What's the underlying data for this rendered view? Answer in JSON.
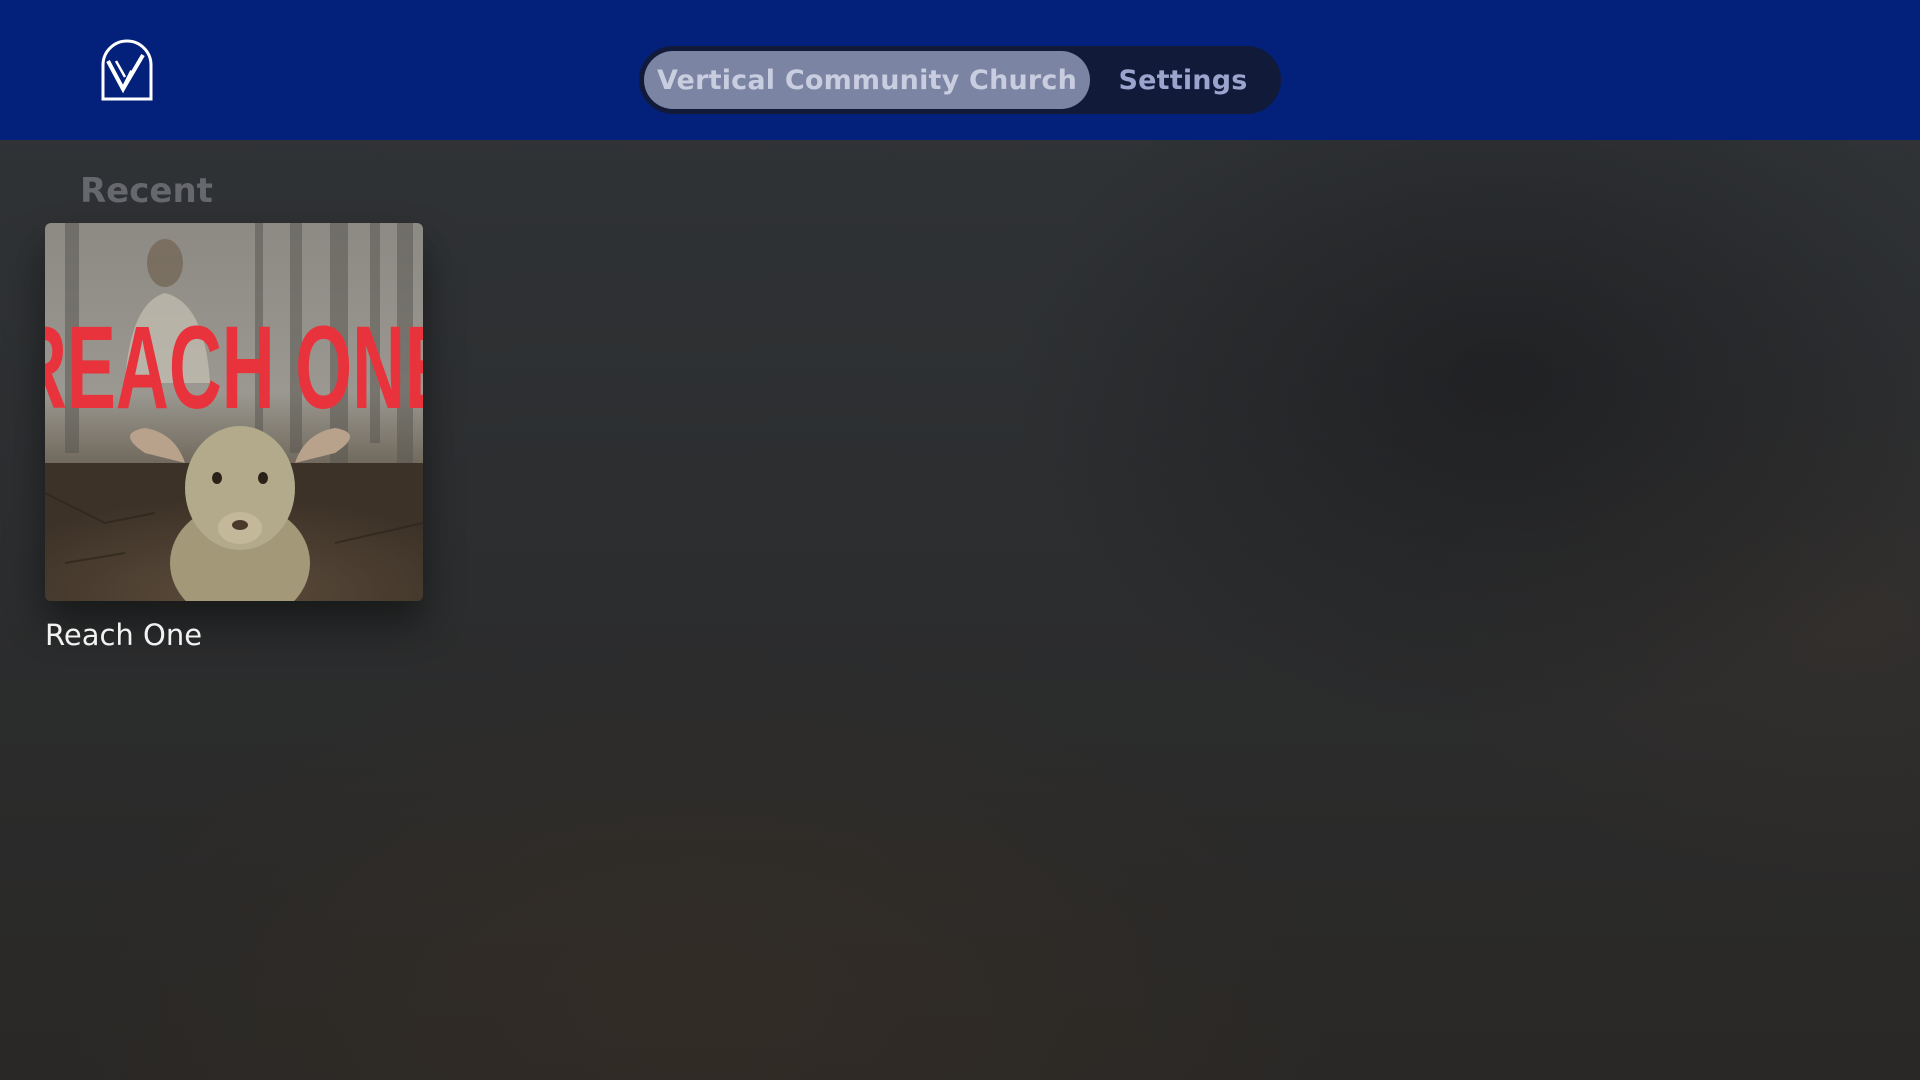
{
  "header": {
    "logo_icon": "vertical-church-logo-icon",
    "tabs": [
      {
        "label": "Vertical Community Church",
        "selected": true
      },
      {
        "label": "Settings",
        "selected": false
      }
    ]
  },
  "recent": {
    "title": "Recent",
    "items": [
      {
        "title": "Reach One",
        "artwork_text": "REACH ONE"
      }
    ]
  },
  "colors": {
    "header_bg": "#03207a",
    "tab_selected_bg": "#7c84a3",
    "artwork_text": "#e8333d"
  }
}
